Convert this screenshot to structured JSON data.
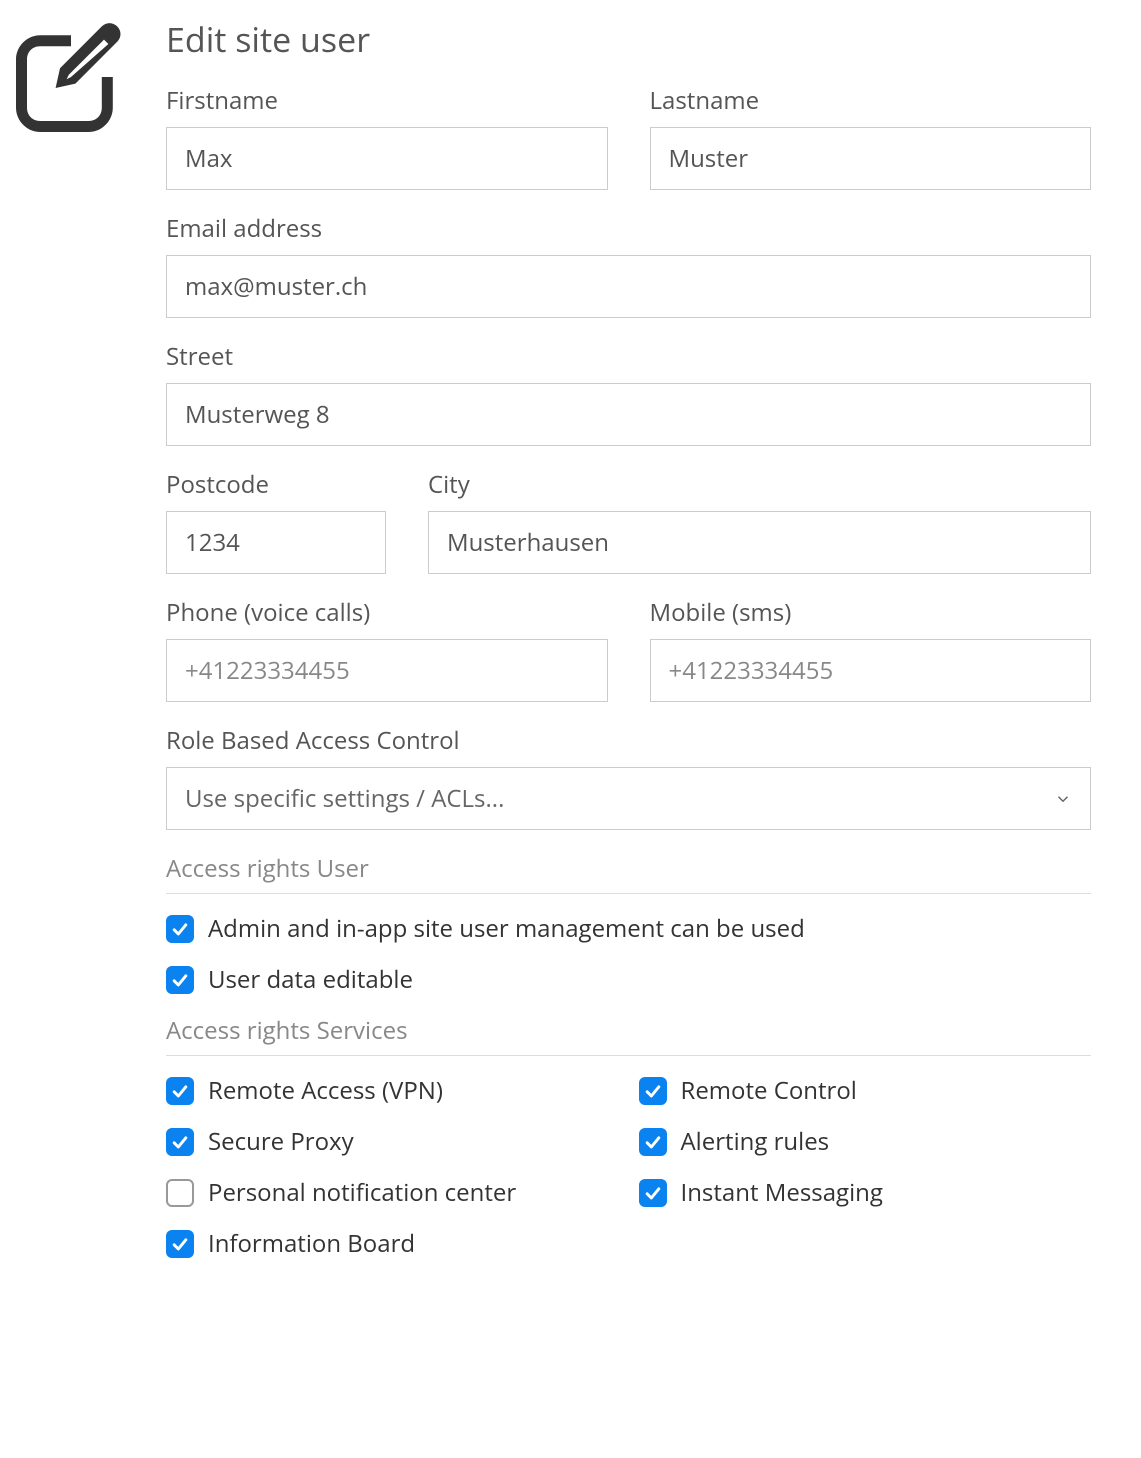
{
  "title": "Edit site user",
  "fields": {
    "firstname": {
      "label": "Firstname",
      "value": "Max"
    },
    "lastname": {
      "label": "Lastname",
      "value": "Muster"
    },
    "email": {
      "label": "Email address",
      "value": "max@muster.ch"
    },
    "street": {
      "label": "Street",
      "value": "Musterweg 8"
    },
    "postcode": {
      "label": "Postcode",
      "value": "1234"
    },
    "city": {
      "label": "City",
      "value": "Musterhausen"
    },
    "phone": {
      "label": "Phone (voice calls)",
      "placeholder": "+41223334455",
      "value": ""
    },
    "mobile": {
      "label": "Mobile (sms)",
      "placeholder": "+41223334455",
      "value": ""
    },
    "rbac": {
      "label": "Role Based Access Control",
      "selected": "Use specific settings / ACLs..."
    }
  },
  "sections": {
    "user": {
      "title": "Access rights User",
      "items": [
        {
          "label": "Admin and in-app site user management can be used",
          "checked": true
        },
        {
          "label": "User data editable",
          "checked": true
        }
      ]
    },
    "services": {
      "title": "Access rights Services",
      "items": [
        {
          "label": "Remote Access (VPN)",
          "checked": true
        },
        {
          "label": "Remote Control",
          "checked": true
        },
        {
          "label": "Secure Proxy",
          "checked": true
        },
        {
          "label": "Alerting rules",
          "checked": true
        },
        {
          "label": "Personal notification center",
          "checked": false
        },
        {
          "label": "Instant Messaging",
          "checked": true
        },
        {
          "label": "Information Board",
          "checked": true
        }
      ]
    }
  }
}
